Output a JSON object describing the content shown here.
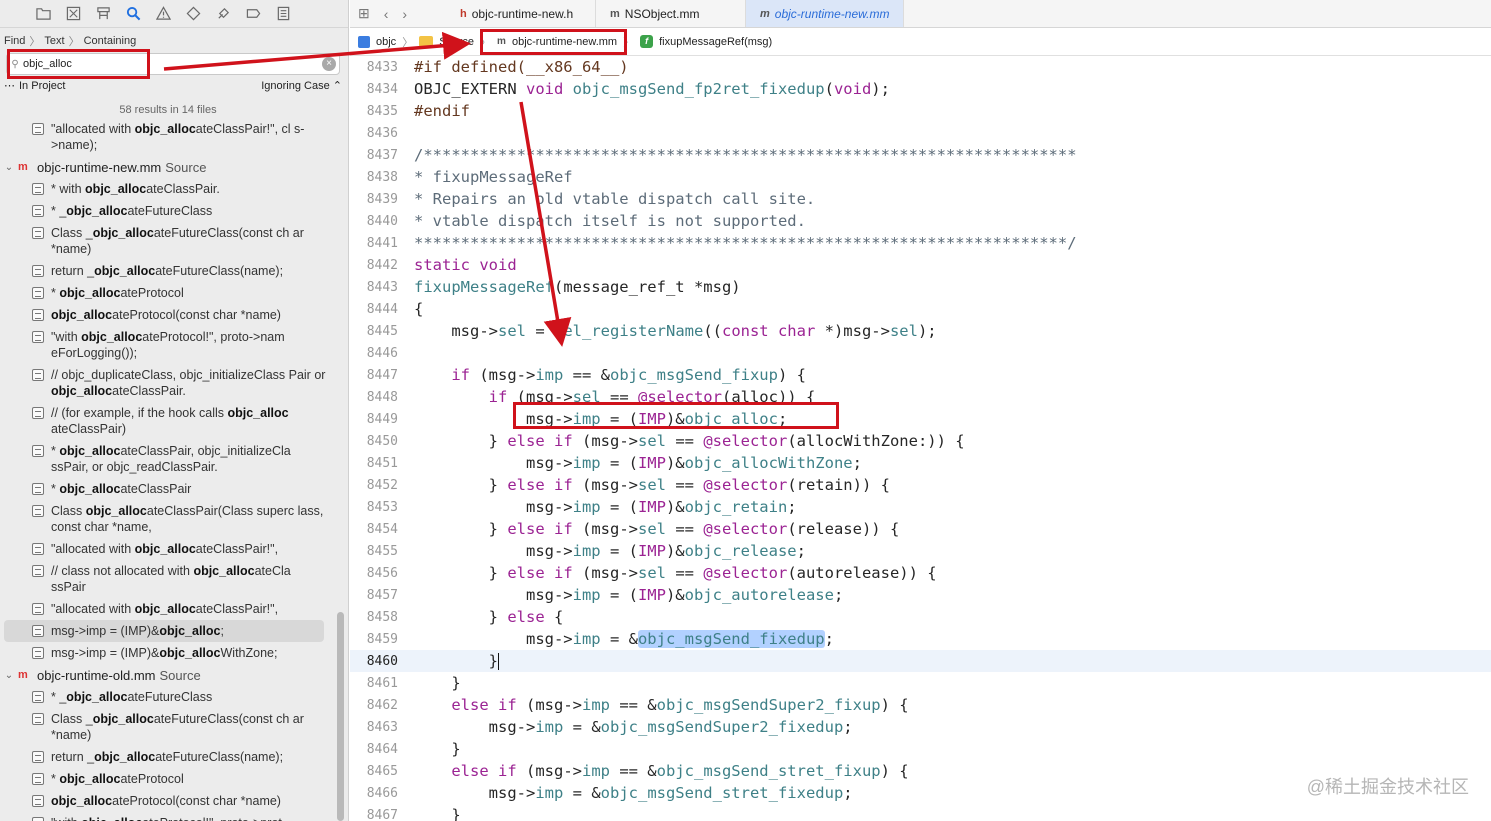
{
  "navigator": {
    "toolbar_icons": [
      "folder-icon",
      "source-control-icon",
      "symbol-icon",
      "find-icon",
      "issue-icon",
      "test-icon",
      "debug-icon",
      "breakpoint-icon",
      "report-icon"
    ],
    "find_path": {
      "find": "Find",
      "text": "Text",
      "containing": "Containing"
    },
    "search": {
      "value": "objc_alloc"
    },
    "scope": {
      "label": "In Project",
      "options_label": "Ignoring Case ⌃"
    },
    "summary": "58 results in 14 files",
    "results": [
      {
        "type": "match",
        "pre": "\"allocated with ",
        "hit": "objc_alloc",
        "post": "ateClassPair!\", cl s->name);"
      },
      {
        "type": "file",
        "name": "objc-runtime-new.mm",
        "source": "Source"
      },
      {
        "type": "match",
        "pre": "* with ",
        "hit": "objc_alloc",
        "post": "ateClassPair."
      },
      {
        "type": "match",
        "pre": "* _",
        "hit": "objc_alloc",
        "post": "ateFutureClass"
      },
      {
        "type": "match",
        "pre": "Class _",
        "hit": "objc_alloc",
        "post": "ateFutureClass(const ch ar *name)"
      },
      {
        "type": "match",
        "pre": "return _",
        "hit": "objc_alloc",
        "post": "ateFutureClass(name);"
      },
      {
        "type": "match",
        "pre": "* ",
        "hit": "objc_alloc",
        "post": "ateProtocol"
      },
      {
        "type": "match",
        "pre": "",
        "hit": "objc_alloc",
        "post": "ateProtocol(const char *name)"
      },
      {
        "type": "match",
        "pre": "\"with ",
        "hit": "objc_alloc",
        "post": "ateProtocol!\", proto->nam eForLogging());"
      },
      {
        "type": "match",
        "pre": "// objc_duplicateClass, objc_initializeClass Pair or ",
        "hit": "objc_alloc",
        "post": "ateClassPair."
      },
      {
        "type": "match",
        "pre": "// (for example, if the hook calls ",
        "hit": "objc_alloc",
        "post": " ateClassPair)"
      },
      {
        "type": "match",
        "pre": "* ",
        "hit": "objc_alloc",
        "post": "ateClassPair, objc_initializeCla ssPair, or objc_readClassPair."
      },
      {
        "type": "match",
        "pre": "* ",
        "hit": "objc_alloc",
        "post": "ateClassPair"
      },
      {
        "type": "match",
        "pre": "Class ",
        "hit": "objc_alloc",
        "post": "ateClassPair(Class superc lass, const char *name,"
      },
      {
        "type": "match",
        "pre": "\"allocated with ",
        "hit": "objc_alloc",
        "post": "ateClassPair!\","
      },
      {
        "type": "match",
        "pre": "// class not allocated with ",
        "hit": "objc_alloc",
        "post": "ateCla ssPair"
      },
      {
        "type": "match",
        "pre": "\"allocated with ",
        "hit": "objc_alloc",
        "post": "ateClassPair!\","
      },
      {
        "type": "match",
        "pre": "msg->imp = (IMP)&",
        "hit": "objc_alloc",
        "post": ";",
        "selected": true
      },
      {
        "type": "match",
        "pre": "msg->imp = (IMP)&",
        "hit": "objc_alloc",
        "post": "WithZone;"
      },
      {
        "type": "file",
        "name": "objc-runtime-old.mm",
        "source": "Source"
      },
      {
        "type": "match",
        "pre": "* _",
        "hit": "objc_alloc",
        "post": "ateFutureClass"
      },
      {
        "type": "match",
        "pre": "Class _",
        "hit": "objc_alloc",
        "post": "ateFutureClass(const ch ar *name)"
      },
      {
        "type": "match",
        "pre": "return _",
        "hit": "objc_alloc",
        "post": "ateFutureClass(name);"
      },
      {
        "type": "match",
        "pre": "* ",
        "hit": "objc_alloc",
        "post": "ateProtocol"
      },
      {
        "type": "match",
        "pre": "",
        "hit": "objc_alloc",
        "post": "ateProtocol(const char *name)"
      },
      {
        "type": "match",
        "pre": "\"with ",
        "hit": "objc_alloc",
        "post": "ateProtocol!\", proto->prot"
      }
    ]
  },
  "editor": {
    "tabs": [
      {
        "icon": "h",
        "label": "objc-runtime-new.h",
        "active": false
      },
      {
        "icon": "m",
        "label": "NSObject.mm",
        "active": false
      },
      {
        "icon": "m",
        "label": "objc-runtime-new.mm",
        "active": true
      }
    ],
    "jumpbar": {
      "project": "objc",
      "folder": "Source",
      "file": "objc-runtime-new.mm",
      "symbol": "fixupMessageRef(msg)"
    },
    "current_line": 8460,
    "lines": [
      {
        "n": 8433,
        "html": "<span class='pp'>#if defined(__x86_64__)</span>"
      },
      {
        "n": 8434,
        "html": "OBJC_EXTERN <span class='kw'>void</span> <span class='fn'>objc_msgSend_fp2ret_fixedup</span>(<span class='kw'>void</span>);"
      },
      {
        "n": 8435,
        "html": "<span class='pp'>#endif</span>"
      },
      {
        "n": 8436,
        "html": ""
      },
      {
        "n": 8437,
        "html": "<span class='cm'>/**********************************************************************</span>"
      },
      {
        "n": 8438,
        "html": "<span class='cm'>* fixupMessageRef</span>"
      },
      {
        "n": 8439,
        "html": "<span class='cm'>* Repairs an old vtable dispatch call site.</span>"
      },
      {
        "n": 8440,
        "html": "<span class='cm'>* vtable dispatch itself is not supported.</span>"
      },
      {
        "n": 8441,
        "html": "<span class='cm'>**********************************************************************/</span>"
      },
      {
        "n": 8442,
        "html": "<span class='kw'>static void</span>"
      },
      {
        "n": 8443,
        "html": "<span class='fn'>fixupMessageRef</span>(message_ref_t *msg)"
      },
      {
        "n": 8444,
        "html": "{"
      },
      {
        "n": 8445,
        "html": "    msg-><span class='fn'>sel</span> = <span class='fn'>sel_registerName</span>((<span class='kw'>const char</span> *)msg-><span class='fn'>sel</span>);"
      },
      {
        "n": 8446,
        "html": ""
      },
      {
        "n": 8447,
        "html": "    <span class='kw'>if</span> (msg-><span class='fn'>imp</span> == &amp;<span class='fn'>objc_msgSend_fixup</span>) {"
      },
      {
        "n": 8448,
        "html": "        <span class='kw'>if</span> (msg-><span class='fn'>sel</span> == <span class='kw'>@selector</span>(alloc)) {"
      },
      {
        "n": 8449,
        "html": "            msg-><span class='fn'>imp</span> = (<span class='kw'>IMP</span>)&amp;<span class='fn'>objc_alloc</span>;"
      },
      {
        "n": 8450,
        "html": "        } <span class='kw'>else if</span> (msg-><span class='fn'>sel</span> == <span class='kw'>@selector</span>(allocWithZone:)) {"
      },
      {
        "n": 8451,
        "html": "            msg-><span class='fn'>imp</span> = (<span class='kw'>IMP</span>)&amp;<span class='fn'>objc_allocWithZone</span>;"
      },
      {
        "n": 8452,
        "html": "        } <span class='kw'>else if</span> (msg-><span class='fn'>sel</span> == <span class='kw'>@selector</span>(retain)) {"
      },
      {
        "n": 8453,
        "html": "            msg-><span class='fn'>imp</span> = (<span class='kw'>IMP</span>)&amp;<span class='fn'>objc_retain</span>;"
      },
      {
        "n": 8454,
        "html": "        } <span class='kw'>else if</span> (msg-><span class='fn'>sel</span> == <span class='kw'>@selector</span>(release)) {"
      },
      {
        "n": 8455,
        "html": "            msg-><span class='fn'>imp</span> = (<span class='kw'>IMP</span>)&amp;<span class='fn'>objc_release</span>;"
      },
      {
        "n": 8456,
        "html": "        } <span class='kw'>else if</span> (msg-><span class='fn'>sel</span> == <span class='kw'>@selector</span>(autorelease)) {"
      },
      {
        "n": 8457,
        "html": "            msg-><span class='fn'>imp</span> = (<span class='kw'>IMP</span>)&amp;<span class='fn'>objc_autorelease</span>;"
      },
      {
        "n": 8458,
        "html": "        } <span class='kw'>else</span> {"
      },
      {
        "n": 8459,
        "html": "            msg-><span class='fn'>imp</span> = &amp;<span class='fn sel-hl'>objc_msgSend_fixedup</span>;"
      },
      {
        "n": 8460,
        "html": "        }<span class='cursor'></span>"
      },
      {
        "n": 8461,
        "html": "    }"
      },
      {
        "n": 8462,
        "html": "    <span class='kw'>else if</span> (msg-><span class='fn'>imp</span> == &amp;<span class='fn'>objc_msgSendSuper2_fixup</span>) {"
      },
      {
        "n": 8463,
        "html": "        msg-><span class='fn'>imp</span> = &amp;<span class='fn'>objc_msgSendSuper2_fixedup</span>;"
      },
      {
        "n": 8464,
        "html": "    }"
      },
      {
        "n": 8465,
        "html": "    <span class='kw'>else if</span> (msg-><span class='fn'>imp</span> == &amp;<span class='fn'>objc_msgSend_stret_fixup</span>) {"
      },
      {
        "n": 8466,
        "html": "        msg-><span class='fn'>imp</span> = &amp;<span class='fn'>objc_msgSend_stret_fixedup</span>;"
      },
      {
        "n": 8467,
        "html": "    }"
      }
    ]
  },
  "watermark": "@稀土掘金技术社区",
  "colors": {
    "annotation_red": "#d0121b",
    "selection_blue": "#b2d1ff",
    "keyword": "#9b2393",
    "identifier": "#3e8087"
  }
}
